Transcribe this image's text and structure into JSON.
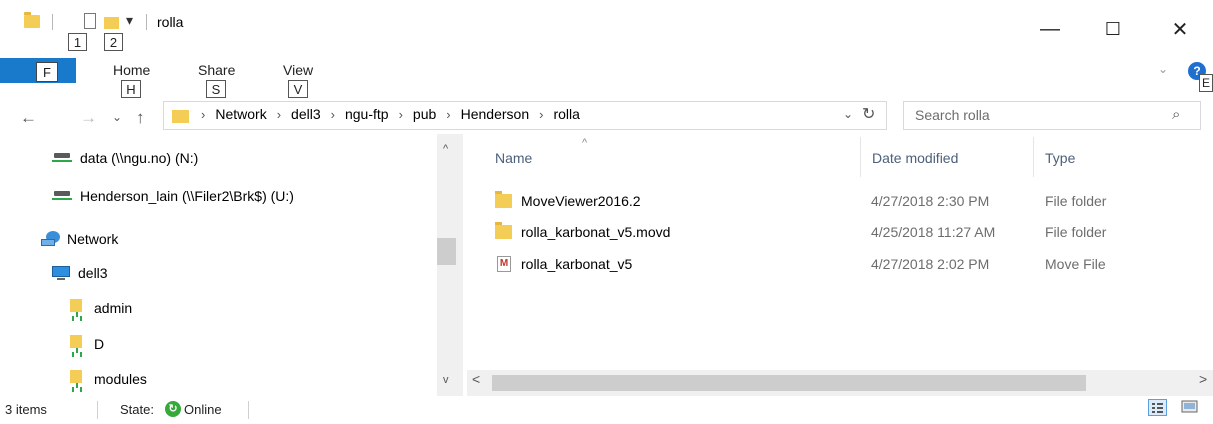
{
  "window": {
    "title": "rolla",
    "controls": {
      "minimize": "—",
      "maximize": "☐",
      "close": "✕"
    }
  },
  "quick_access": {
    "keytips": [
      "1",
      "2"
    ],
    "dropdown": "▾"
  },
  "ribbon": {
    "file_keytip": "F",
    "tabs": [
      {
        "label": "Home",
        "keytip": "H"
      },
      {
        "label": "Share",
        "keytip": "S"
      },
      {
        "label": "View",
        "keytip": "V"
      }
    ],
    "expand_chevron": "⌄",
    "help_keytip": "E",
    "help_glyph": "?"
  },
  "navigation": {
    "back": "←",
    "forward": "→",
    "recent": "⌄",
    "up": "↑",
    "breadcrumbs": [
      "Network",
      "dell3",
      "ngu-ftp",
      "pub",
      "Henderson",
      "rolla"
    ],
    "crumb_separator": "›",
    "address_dropdown": "⌄",
    "refresh": "↻"
  },
  "search": {
    "placeholder": "Search rolla",
    "icon": "⌕"
  },
  "nav_pane": {
    "items": [
      {
        "label": "data (\\\\ngu.no) (N:)",
        "icon": "network-drive-icon"
      },
      {
        "label": "Henderson_lain (\\\\Filer2\\Brk$) (U:)",
        "icon": "network-drive-icon"
      },
      {
        "label": "Network",
        "icon": "network-icon"
      },
      {
        "label": "dell3",
        "icon": "computer-icon"
      },
      {
        "label": "admin",
        "icon": "shared-folder-icon"
      },
      {
        "label": "D",
        "icon": "shared-folder-icon"
      },
      {
        "label": "modules",
        "icon": "shared-folder-icon"
      }
    ],
    "scroll_up": "^",
    "scroll_down": "v"
  },
  "file_list": {
    "columns": [
      "Name",
      "Date modified",
      "Type"
    ],
    "sort_indicator": "^",
    "rows": [
      {
        "name": "MoveViewer2016.2",
        "date": "4/27/2018 2:30 PM",
        "type": "File folder",
        "icon": "folder-icon"
      },
      {
        "name": "rolla_karbonat_v5.movd",
        "date": "4/25/2018 11:27 AM",
        "type": "File folder",
        "icon": "folder-icon"
      },
      {
        "name": "rolla_karbonat_v5",
        "date": "4/27/2018 2:02 PM",
        "type": "Move File",
        "icon": "move-file-icon",
        "icon_letter": "M"
      }
    ],
    "hscroll_left": "<",
    "hscroll_right": ">"
  },
  "status_bar": {
    "item_count": "3 items",
    "state_label": "State:",
    "state_value": "Online"
  }
}
